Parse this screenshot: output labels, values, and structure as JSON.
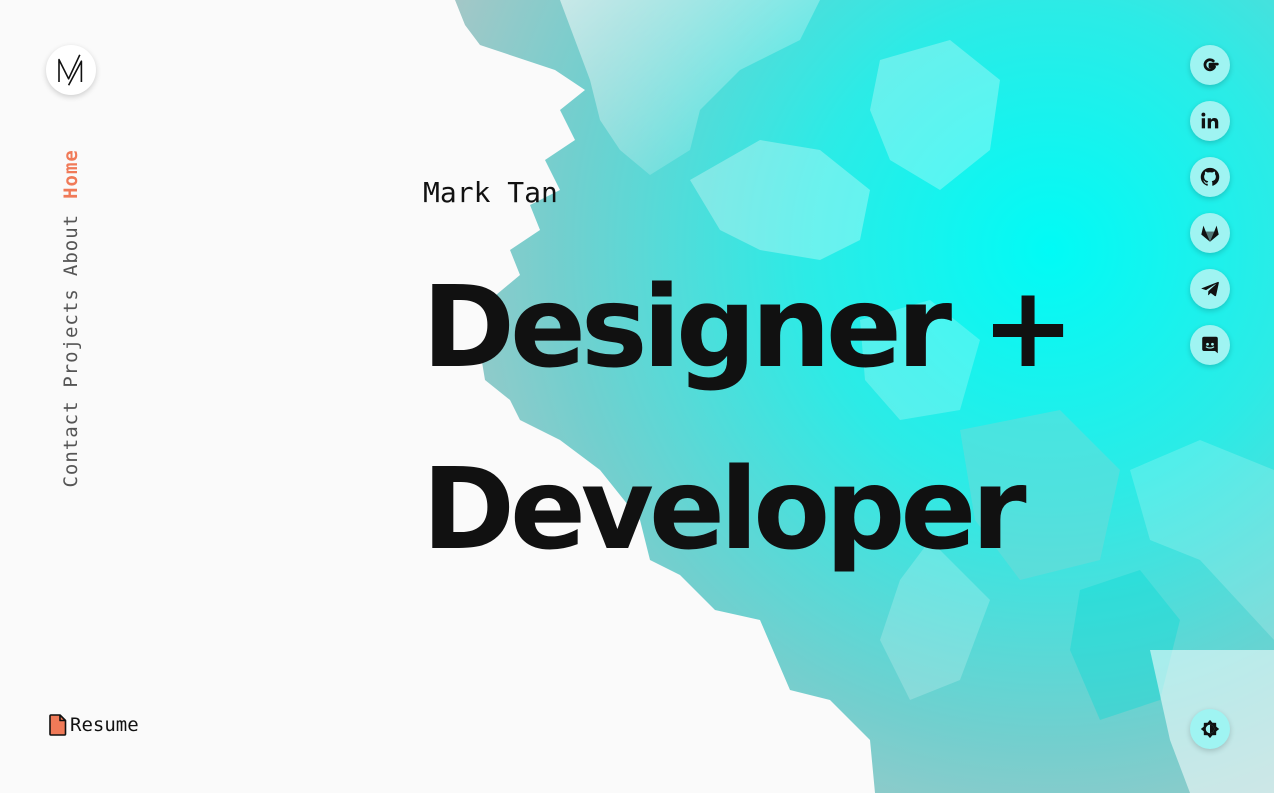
{
  "brand": {
    "logo_icon": "mt-monogram-logo"
  },
  "nav": {
    "items": [
      {
        "label": "Home",
        "active": true
      },
      {
        "label": "About",
        "active": false
      },
      {
        "label": "Projects",
        "active": false
      },
      {
        "label": "Contact",
        "active": false
      }
    ],
    "active_color": "#f07a58"
  },
  "hero": {
    "name": "Mark Tan",
    "headline_line1": "Designer +",
    "headline_line2": "Developer"
  },
  "social": [
    {
      "icon": "google-icon"
    },
    {
      "icon": "linkedin-icon"
    },
    {
      "icon": "github-icon"
    },
    {
      "icon": "gitlab-icon"
    },
    {
      "icon": "telegram-icon"
    },
    {
      "icon": "discord-icon"
    }
  ],
  "resume": {
    "label": "Resume",
    "icon": "file-icon"
  },
  "theme_toggle": {
    "icon": "theme-toggle-icon"
  },
  "colors": {
    "accent": "#f07a58",
    "cyan": "#00f5f0",
    "background": "#fafafa"
  }
}
